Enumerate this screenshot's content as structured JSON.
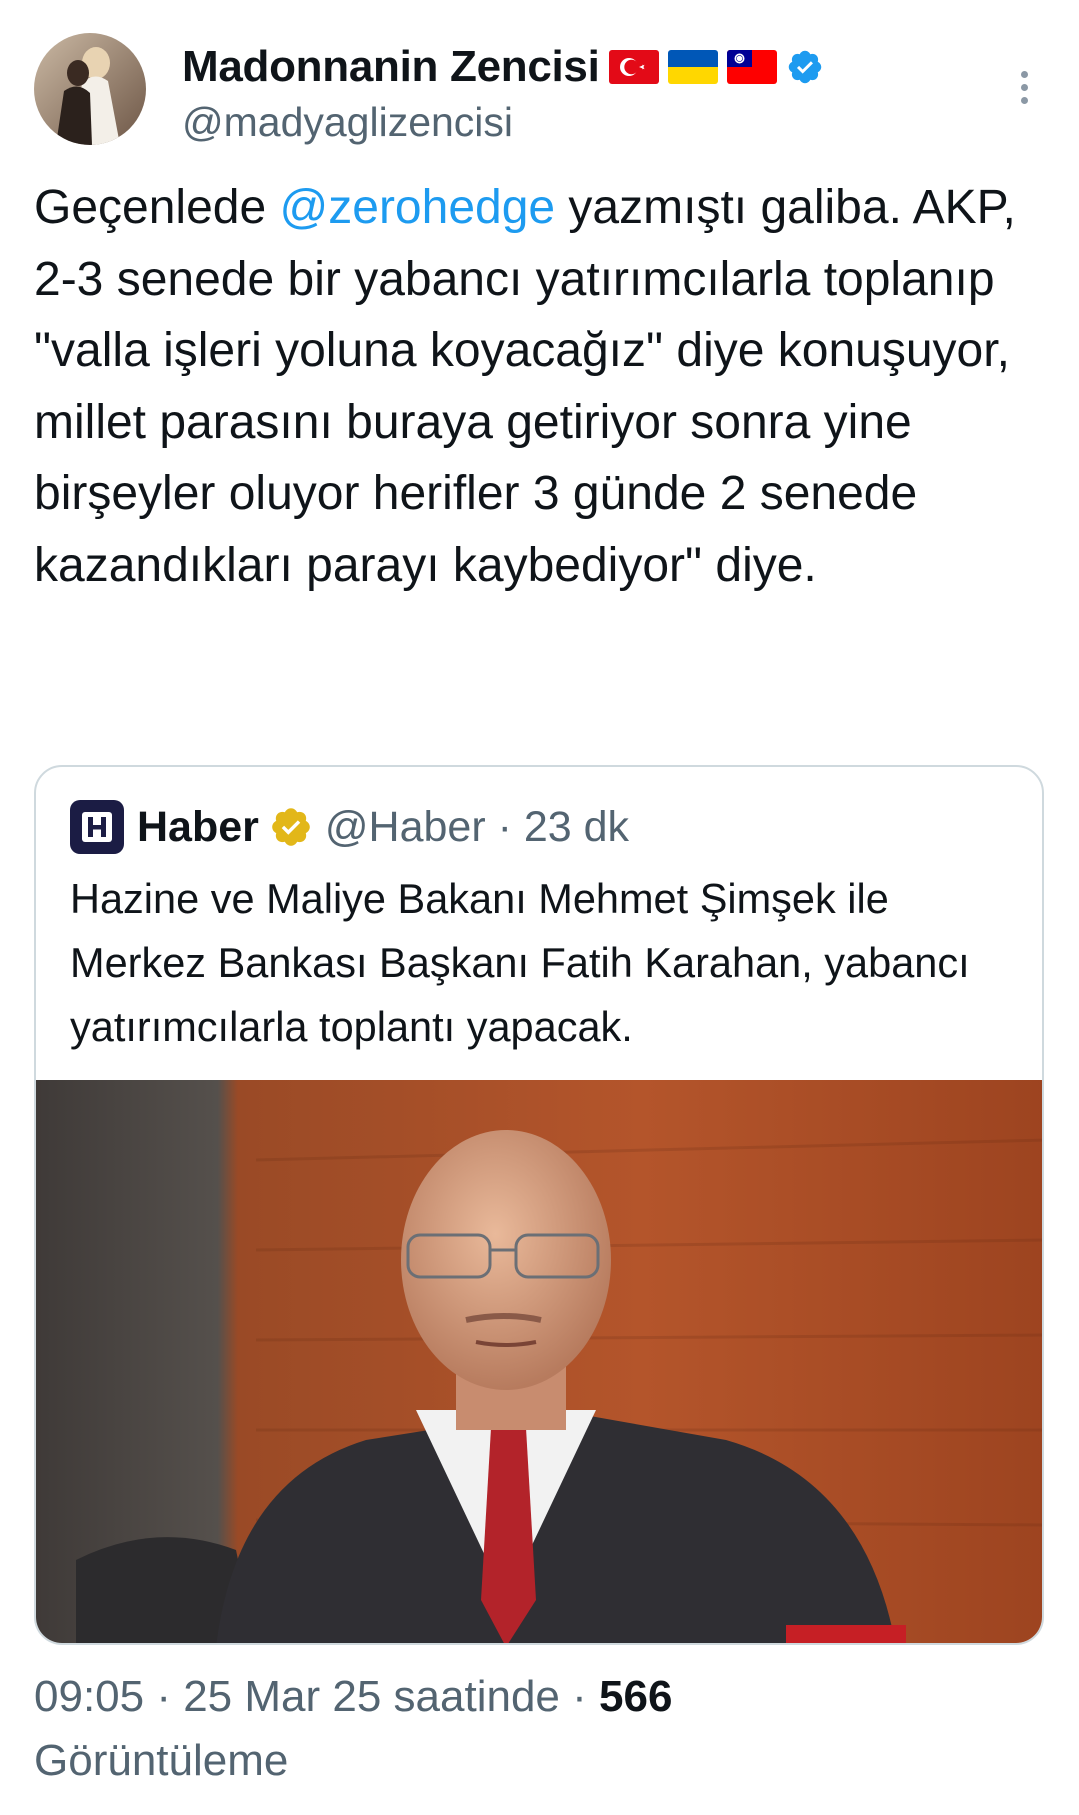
{
  "author": {
    "display_name": "Madonnanin Zencisi",
    "handle": "@madyaglizencisi",
    "flags": [
      "turkey-flag-icon",
      "ukraine-flag-icon",
      "taiwan-flag-icon"
    ],
    "verified_color": "#1d9bf0"
  },
  "tweet": {
    "text_before": "Geçenlede ",
    "mention": "@zerohedge",
    "text_after": " yazmıştı galiba. AKP, 2-3 senede bir yabancı yatırımcılarla toplanıp \"valla işleri yoluna koyacağız\" diye konuşuyor, millet parasını buraya getiriyor sonra yine birşeyler oluyor herifler 3 günde 2 senede kazandıkları parayı kaybediyor\" diye."
  },
  "quote": {
    "logo_letter": "H",
    "name": "Haber",
    "handle_time": "@Haber · 23 dk",
    "text": "Hazine ve Maliye Bakanı Mehmet Şimşek ile Merkez Bankası Başkanı Fatih Karahan, yabancı yatırımcılarla toplantı yapacak.",
    "badge_color": "#e2b719"
  },
  "meta": {
    "time_date": "09:05 · 25 Mar 25 saatinde · ",
    "views_count": "566",
    "views_label": "Görüntüleme"
  },
  "colors": {
    "link": "#1d9bf0",
    "secondary_text": "#536471",
    "border": "#cfd9de"
  }
}
